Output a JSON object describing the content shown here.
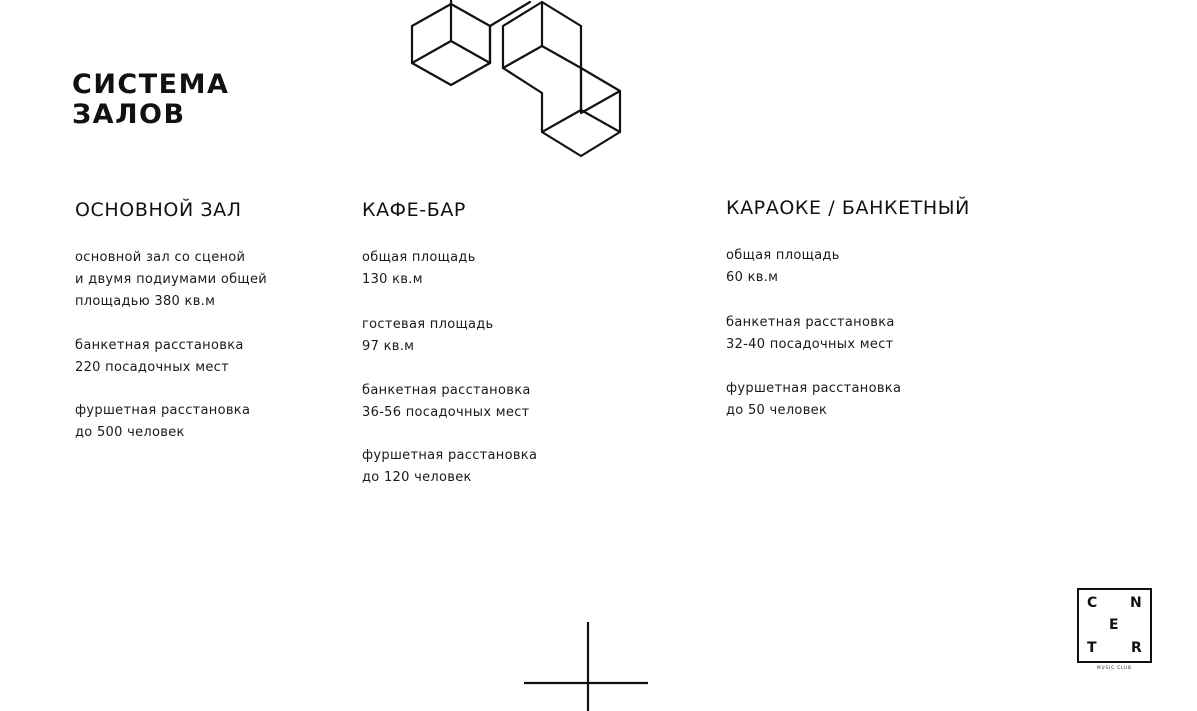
{
  "title": {
    "line1": "СИСТЕМА",
    "line2": "ЗАЛОВ"
  },
  "halls": [
    {
      "name": "ОСНОВНОЙ ЗАЛ",
      "blocks": [
        [
          "основной зал со сценой",
          "и двумя подиумами общей",
          "площадью 380 кв.м"
        ],
        [
          "банкетная расстановка",
          "220 посадочных мест"
        ],
        [
          "фуршетная расстановка",
          "до 500 человек"
        ]
      ]
    },
    {
      "name": "КАФЕ-БАР",
      "blocks": [
        [
          "общая площадь",
          "130 кв.м"
        ],
        [
          "гостевая площадь",
          "97 кв.м"
        ],
        [
          "банкетная расстановка",
          "36-56 посадочных мест"
        ],
        [
          "фуршетная расстановка",
          "до 120 человек"
        ]
      ]
    },
    {
      "name": "КАРАОКЕ / БАНКЕТНЫЙ",
      "blocks": [
        [
          "общая площадь",
          "60 кв.м"
        ],
        [
          "банкетная расстановка",
          "32-40 посадочных мест"
        ],
        [
          "фуршетная расстановка",
          "до 50 человек"
        ]
      ]
    }
  ],
  "logo": {
    "letters": [
      "C",
      "N",
      "E",
      "T",
      "R"
    ],
    "subtitle": "MUSIC CLUB"
  },
  "icons": {
    "decoration": "isometric-cubes-icon",
    "crosshair": "crosshair-icon"
  },
  "colors": {
    "ink": "#111111",
    "background": "#ffffff"
  }
}
